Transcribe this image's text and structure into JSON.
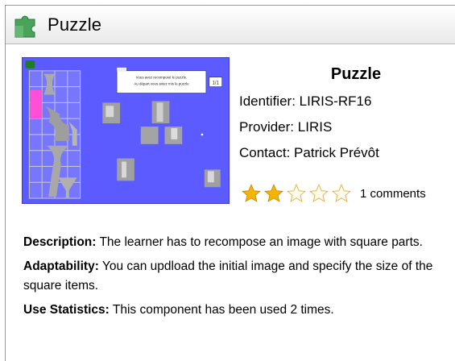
{
  "window": {
    "title": "Puzzle",
    "icon": "puzzle-piece-icon"
  },
  "thumbnail": {
    "caption": "Vous avez recomposé le puzzle. Au départ vous aviez mis le puzzle",
    "badge_text": "1/1"
  },
  "component": {
    "name": "Puzzle",
    "identifier_label": "Identifier:",
    "identifier": "LIRIS-RF16",
    "provider_label": "Provider:",
    "provider": "LIRIS",
    "contact_label": "Contact:",
    "contact": "Patrick Prévôt"
  },
  "rating": {
    "stars_filled": 2,
    "stars_total": 5,
    "comments_text": "1 comments"
  },
  "details": {
    "description_label": "Description:",
    "description": "The learner has to recompose an image with square parts.",
    "adaptability_label": "Adaptability:",
    "adaptability": "You can updload the initial image and specify the size of the square items.",
    "stats_label": "Use Statistics:",
    "stats": "This component has been used 2 times."
  },
  "colors": {
    "thumbnail_bg": "#5b5bff",
    "star_filled": "#f5b400",
    "star_empty": "#f3d98a"
  }
}
